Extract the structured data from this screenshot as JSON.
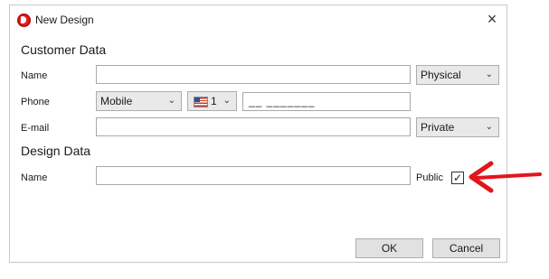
{
  "window": {
    "title": "New Design"
  },
  "customer_section": {
    "heading": "Customer Data",
    "name_label": "Name",
    "name_value": "",
    "address_type": "Physical",
    "phone_label": "Phone",
    "phone_type": "Mobile",
    "country_code": "1",
    "phone_mask": "__ _______",
    "email_label": "E-mail",
    "email_value": "",
    "email_type": "Private"
  },
  "design_section": {
    "heading": "Design Data",
    "name_label": "Name",
    "name_value": "",
    "public_label": "Public",
    "public_checked": true,
    "check_glyph": "✓"
  },
  "buttons": {
    "ok": "OK",
    "cancel": "Cancel"
  },
  "icons": {
    "close": "×",
    "chevron": "⌄"
  },
  "colors": {
    "annotation_arrow": "#e3151b",
    "app_icon": "#e02424"
  }
}
